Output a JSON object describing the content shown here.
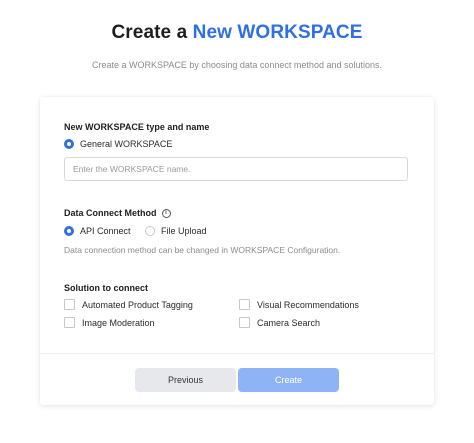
{
  "header": {
    "title_prefix": "Create a ",
    "title_accent": "New WORKSPACE",
    "subtitle": "Create a WORKSPACE by choosing data connect method and solutions."
  },
  "workspace": {
    "section_label": "New WORKSPACE type and name",
    "type_option": "General WORKSPACE",
    "name_placeholder": "Enter the WORKSPACE name."
  },
  "data_connect": {
    "section_label": "Data Connect Method",
    "info_icon": "info-icon",
    "options": [
      "API Connect",
      "File Upload"
    ],
    "selected": "API Connect",
    "hint": "Data connection method can be changed in WORKSPACE Configuration."
  },
  "solutions": {
    "section_label": "Solution to connect",
    "items": [
      "Automated Product Tagging",
      "Visual Recommendations",
      "Image Moderation",
      "Camera Search"
    ]
  },
  "footer": {
    "previous_label": "Previous",
    "create_label": "Create"
  },
  "colors": {
    "accent": "#2f6fe6",
    "create_disabled": "#8fb4f5",
    "previous_bg": "#e7e8ec"
  }
}
